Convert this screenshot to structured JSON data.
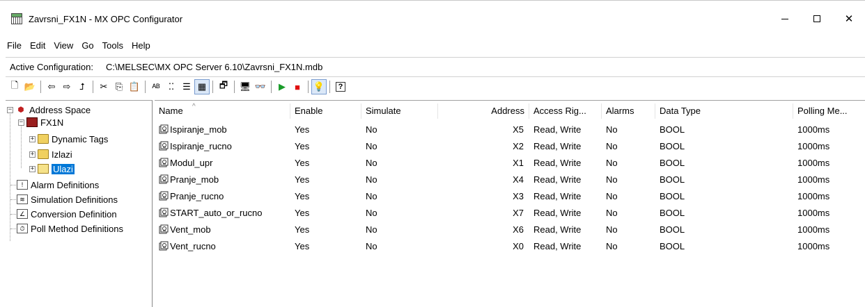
{
  "window": {
    "title": "Zavrsni_FX1N - MX OPC Configurator",
    "minimize": "—",
    "maximize": "☐",
    "close": "✕"
  },
  "menu": [
    "File",
    "Edit",
    "View",
    "Go",
    "Tools",
    "Help"
  ],
  "config": {
    "label": "Active Configuration:",
    "path": "C:\\MELSEC\\MX OPC Server 6.10\\Zavrsni_FX1N.mdb"
  },
  "toolbar": [
    {
      "icon": "new-icon",
      "glyph": "🗋"
    },
    {
      "icon": "open-icon",
      "glyph": "📂"
    },
    {
      "sep": true
    },
    {
      "icon": "back-icon",
      "glyph": "⇦"
    },
    {
      "icon": "forward-icon",
      "glyph": "⇨"
    },
    {
      "icon": "up-folder-icon",
      "glyph": "⮥"
    },
    {
      "sep": true
    },
    {
      "icon": "cut-icon",
      "glyph": "✂"
    },
    {
      "icon": "copy-icon",
      "glyph": "⎘"
    },
    {
      "icon": "paste-icon",
      "glyph": "📋"
    },
    {
      "sep": true
    },
    {
      "icon": "large-icons-icon",
      "glyph": "ᴬᴮ"
    },
    {
      "icon": "small-icons-icon",
      "glyph": "⁚⁚"
    },
    {
      "icon": "list-view-icon",
      "glyph": "☰"
    },
    {
      "icon": "details-view-icon",
      "glyph": "▦",
      "pressed": true
    },
    {
      "sep": true
    },
    {
      "icon": "properties-icon",
      "glyph": "🗗"
    },
    {
      "sep": true
    },
    {
      "icon": "monitor-icon",
      "glyph": "🖥"
    },
    {
      "icon": "watch-icon",
      "glyph": "👓"
    },
    {
      "sep": true
    },
    {
      "icon": "run-icon",
      "glyph": "▶",
      "color": "#1a9c2a"
    },
    {
      "icon": "stop-icon",
      "glyph": "■",
      "color": "#e01010"
    },
    {
      "sep": true
    },
    {
      "icon": "bulb-icon",
      "glyph": "💡",
      "pressed": true
    },
    {
      "sep": true
    },
    {
      "icon": "help-icon",
      "glyph": "?"
    }
  ],
  "tree": {
    "root": "Address Space",
    "device": "FX1N",
    "device_children": [
      "Dynamic Tags",
      "Izlazi",
      "Ulazi"
    ],
    "selected": "Ulazi",
    "others": [
      "Alarm Definitions",
      "Simulation Definitions",
      "Conversion Definition",
      "Poll Method Definitions"
    ]
  },
  "columns": [
    "Name",
    "Enable",
    "Simulate",
    "Address",
    "Access Rig...",
    "Alarms",
    "Data Type",
    "Polling Me..."
  ],
  "rows": [
    {
      "name": "Ispiranje_mob",
      "enable": "Yes",
      "simulate": "No",
      "address": "X5",
      "access": "Read, Write",
      "alarms": "No",
      "type": "BOOL",
      "poll": "1000ms"
    },
    {
      "name": "Ispiranje_rucno",
      "enable": "Yes",
      "simulate": "No",
      "address": "X2",
      "access": "Read, Write",
      "alarms": "No",
      "type": "BOOL",
      "poll": "1000ms"
    },
    {
      "name": "Modul_upr",
      "enable": "Yes",
      "simulate": "No",
      "address": "X1",
      "access": "Read, Write",
      "alarms": "No",
      "type": "BOOL",
      "poll": "1000ms"
    },
    {
      "name": "Pranje_mob",
      "enable": "Yes",
      "simulate": "No",
      "address": "X4",
      "access": "Read, Write",
      "alarms": "No",
      "type": "BOOL",
      "poll": "1000ms"
    },
    {
      "name": "Pranje_rucno",
      "enable": "Yes",
      "simulate": "No",
      "address": "X3",
      "access": "Read, Write",
      "alarms": "No",
      "type": "BOOL",
      "poll": "1000ms"
    },
    {
      "name": "START_auto_or_rucno",
      "enable": "Yes",
      "simulate": "No",
      "address": "X7",
      "access": "Read, Write",
      "alarms": "No",
      "type": "BOOL",
      "poll": "1000ms"
    },
    {
      "name": "Vent_mob",
      "enable": "Yes",
      "simulate": "No",
      "address": "X6",
      "access": "Read, Write",
      "alarms": "No",
      "type": "BOOL",
      "poll": "1000ms"
    },
    {
      "name": "Vent_rucno",
      "enable": "Yes",
      "simulate": "No",
      "address": "X0",
      "access": "Read, Write",
      "alarms": "No",
      "type": "BOOL",
      "poll": "1000ms"
    }
  ]
}
